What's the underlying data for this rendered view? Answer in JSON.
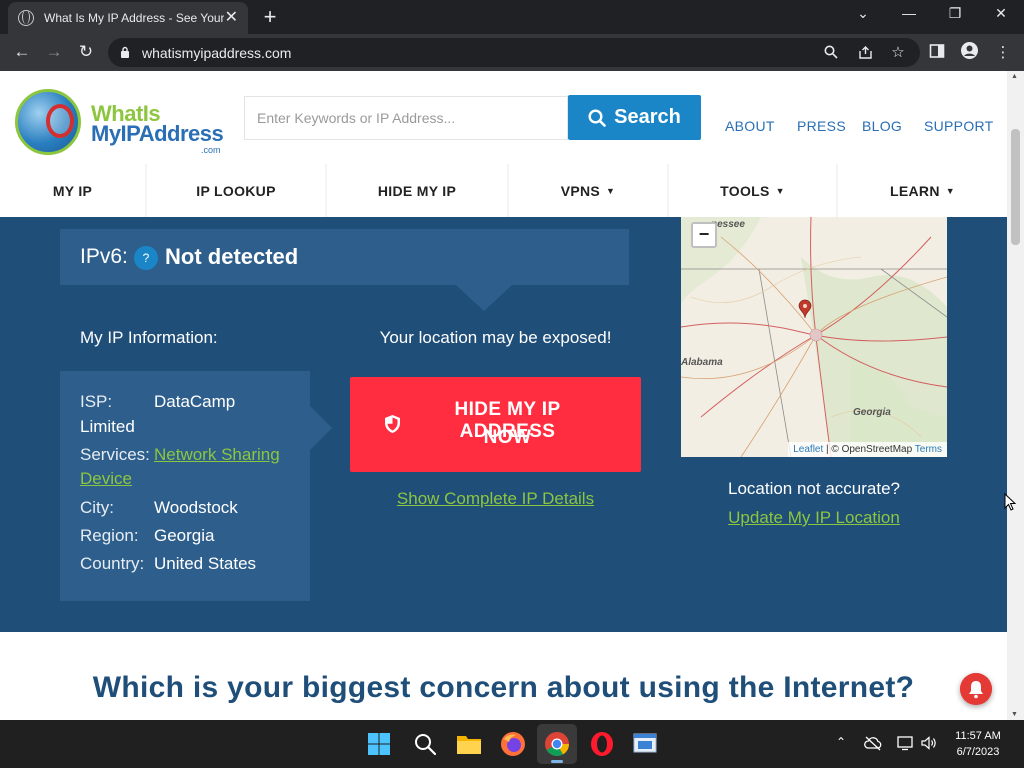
{
  "browser": {
    "tab_title": "What Is My IP Address - See Your",
    "tab_close": "✕",
    "new_tab": "+",
    "url": "whatismyipaddress.com",
    "window": {
      "minimize": "—",
      "restore": "❐",
      "close": "✕",
      "tab_list": "⌄"
    }
  },
  "header": {
    "logo_line1": "WhatIs",
    "logo_line2": "MyIPAddress",
    "logo_line3": ".com",
    "search_placeholder": "Enter Keywords or IP Address...",
    "search_button": "Search",
    "top_links": [
      "ABOUT",
      "PRESS",
      "BLOG",
      "SUPPORT"
    ]
  },
  "nav": {
    "items": [
      {
        "label": "MY IP",
        "caret": ""
      },
      {
        "label": "IP LOOKUP",
        "caret": ""
      },
      {
        "label": "HIDE MY IP",
        "caret": ""
      },
      {
        "label": "VPNS",
        "caret": "▼"
      },
      {
        "label": "TOOLS",
        "caret": "▼"
      },
      {
        "label": "LEARN",
        "caret": "▼"
      }
    ]
  },
  "ip": {
    "ipv6_label": "IPv6:",
    "ipv6_help": "?",
    "ipv6_value": "Not detected",
    "info_heading": "My IP Information:",
    "exposed_heading": "Your location may be exposed!",
    "isp_key": "ISP:",
    "isp_value_1": "DataCamp",
    "isp_value_2": "Limited",
    "services_key": "Services:",
    "services_value_1": "Network Sharing",
    "services_value_2": "Device",
    "city_key": "City:",
    "city_value": "Woodstock",
    "region_key": "Region:",
    "region_value": "Georgia",
    "country_key": "Country:",
    "country_value": "United States",
    "hide_button_1": "HIDE MY IP ADDRESS",
    "hide_button_2": "NOW",
    "details_link": "Show Complete IP Details",
    "not_accurate": "Location not accurate?",
    "update_link": "Update My IP Location"
  },
  "map": {
    "zoom_out": "−",
    "label_tennessee": "nessee",
    "label_alabama": "Alabama",
    "label_georgia": "Georgia",
    "attribution_leaflet": "Leaflet",
    "attribution_mid": " | © OpenStreetMap ",
    "attribution_terms": "Terms"
  },
  "content": {
    "concern_heading": "Which is your biggest concern about using the Internet?"
  },
  "taskbar": {
    "time": "11:57 AM",
    "date": "6/7/2023"
  },
  "colors": {
    "panel_blue": "#1f4e79",
    "panel_box": "#2e5f8c",
    "accent_green": "#8cc63f",
    "hide_red": "#ff2d3f",
    "search_blue": "#1a86c8"
  }
}
